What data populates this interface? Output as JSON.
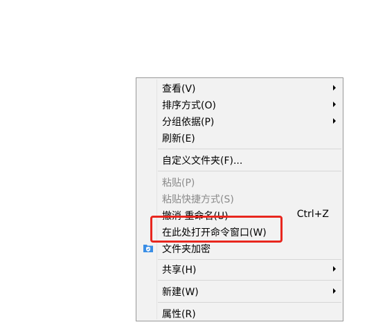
{
  "context_menu": {
    "items": [
      {
        "label": "查看(V)",
        "submenu": true
      },
      {
        "label": "排序方式(O)",
        "submenu": true
      },
      {
        "label": "分组依据(P)",
        "submenu": true
      },
      {
        "label": "刷新(E)"
      },
      {
        "label": "自定义文件夹(F)..."
      },
      {
        "label": "粘贴(P)",
        "disabled": true
      },
      {
        "label": "粘贴快捷方式(S)",
        "disabled": true
      },
      {
        "label": "撤消 重命名(U)",
        "shortcut": "Ctrl+Z"
      },
      {
        "label": "在此处打开命令窗口(W)"
      },
      {
        "label": "文件夹加密",
        "icon": "folder-shield-icon"
      },
      {
        "label": "共享(H)",
        "submenu": true
      },
      {
        "label": "新建(W)",
        "submenu": true
      },
      {
        "label": "属性(R)"
      }
    ]
  },
  "colors": {
    "menu_background": "#f2f2f2",
    "highlight_border": "#e8261e",
    "disabled_text": "#8a8a8a"
  }
}
